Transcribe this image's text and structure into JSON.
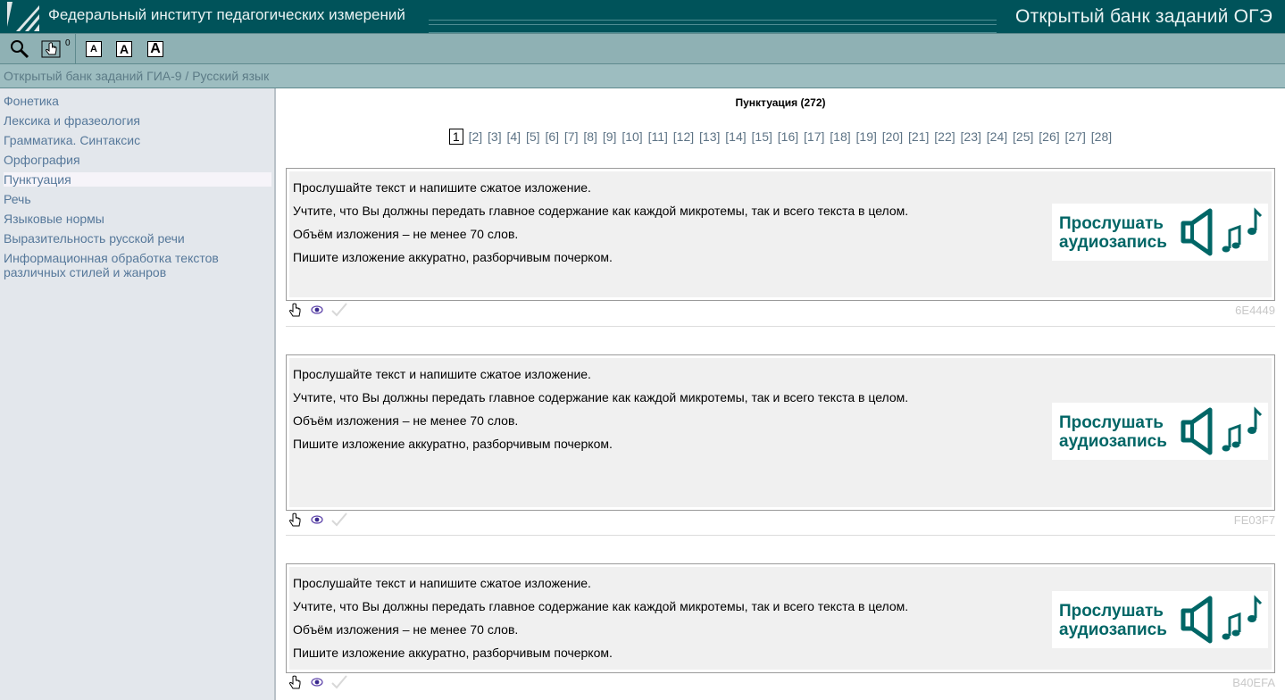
{
  "header": {
    "org_title": "Федеральный институт педагогических измерений",
    "bank_title": "Открытый банк заданий ОГЭ",
    "brand_color": "#00535a"
  },
  "toolbar": {
    "hand_count": "0",
    "font_small": "A",
    "font_medium": "A",
    "font_large": "A"
  },
  "breadcrumb": "Открытый банк заданий ГИА-9 / Русский язык",
  "sidebar": {
    "items": [
      {
        "label": "Фонетика"
      },
      {
        "label": "Лексика и фразеология"
      },
      {
        "label": "Грамматика. Синтаксис"
      },
      {
        "label": "Орфография"
      },
      {
        "label": "Пунктуация",
        "active": true
      },
      {
        "label": "Речь"
      },
      {
        "label": "Языковые нормы"
      },
      {
        "label": "Выразительность русской речи"
      },
      {
        "label": "Информационная обработка текстов различных стилей и жанров"
      }
    ]
  },
  "main": {
    "title": "Пунктуация (272)",
    "pager": [
      "1",
      "[2]",
      "[3]",
      "[4]",
      "[5]",
      "[6]",
      "[7]",
      "[8]",
      "[9]",
      "[10]",
      "[11]",
      "[12]",
      "[13]",
      "[14]",
      "[15]",
      "[16]",
      "[17]",
      "[18]",
      "[19]",
      "[20]",
      "[21]",
      "[22]",
      "[23]",
      "[24]",
      "[25]",
      "[26]",
      "[27]",
      "[28]"
    ],
    "tasks": [
      {
        "lines": [
          "Прослушайте текст и напишите сжатое изложение.",
          "Учтите, что Вы должны передать главное содержание как каждой микротемы, так и всего текста в целом.",
          "Объём изложения – не менее 70 слов.",
          "Пишите изложение аккуратно, разборчивым почерком."
        ],
        "audio_line1": "Прослушать",
        "audio_line2": "аудиозапись",
        "id": "6E4449"
      },
      {
        "lines": [
          "Прослушайте текст и напишите сжатое изложение.",
          "Учтите, что Вы должны передать главное содержание как каждой микротемы, так и всего текста в целом.",
          "Объём изложения – не менее 70 слов.",
          "Пишите изложение аккуратно, разборчивым почерком."
        ],
        "audio_line1": "Прослушать",
        "audio_line2": "аудиозапись",
        "id": "FE03F7"
      },
      {
        "lines": [
          "Прослушайте текст и напишите сжатое изложение.",
          "Учтите, что Вы должны передать главное содержание как каждой микротемы, так и всего текста в целом.",
          "Объём изложения – не менее 70 слов.",
          "Пишите изложение аккуратно, разборчивым почерком."
        ],
        "audio_line1": "Прослушать",
        "audio_line2": "аудиозапись",
        "id": "B40EFA"
      }
    ]
  }
}
